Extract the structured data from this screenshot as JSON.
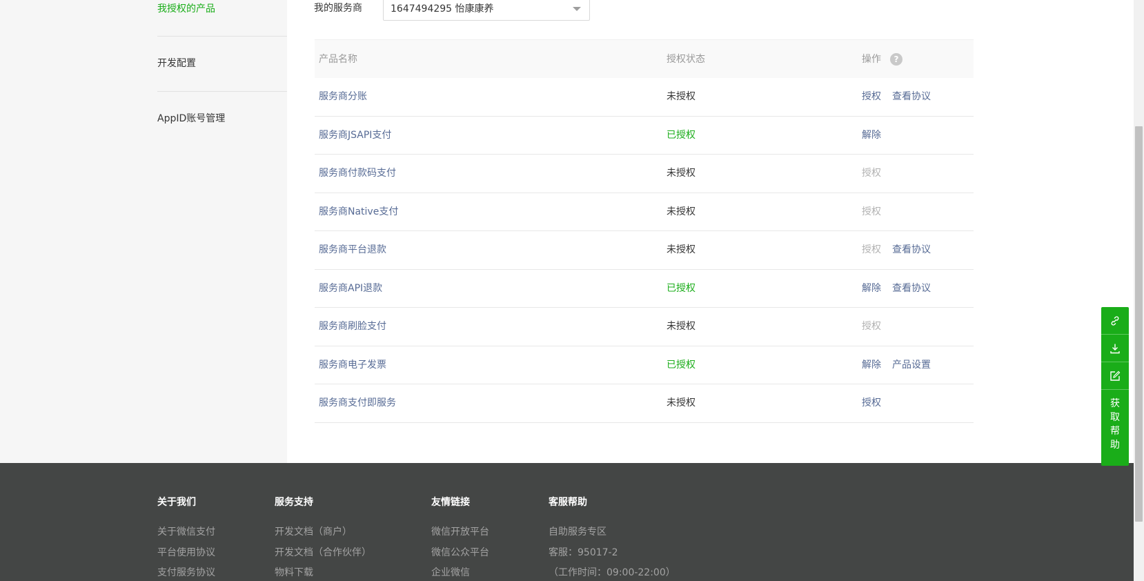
{
  "sidebar": {
    "items": [
      {
        "label": "我授权的产品"
      },
      {
        "label": "开发配置"
      },
      {
        "label": "AppID账号管理"
      }
    ]
  },
  "filter": {
    "label": "我的服务商",
    "selected": "1647494295 怡康康养"
  },
  "table": {
    "headers": {
      "name": "产品名称",
      "status": "授权状态",
      "op": "操作"
    },
    "help_icon": "?",
    "rows": [
      {
        "name": "服务商分账",
        "status": "未授权",
        "op1": "授权",
        "op2": "查看协议"
      },
      {
        "name": "服务商JSAPI支付",
        "status": "已授权",
        "op1": "解除",
        "op2": ""
      },
      {
        "name": "服务商付款码支付",
        "status": "未授权",
        "op1": "授权",
        "op2": ""
      },
      {
        "name": "服务商Native支付",
        "status": "未授权",
        "op1": "授权",
        "op2": ""
      },
      {
        "name": "服务商平台退款",
        "status": "未授权",
        "op1": "授权",
        "op2": "查看协议"
      },
      {
        "name": "服务商API退款",
        "status": "已授权",
        "op1": "解除",
        "op2": "查看协议"
      },
      {
        "name": "服务商刷脸支付",
        "status": "未授权",
        "op1": "授权",
        "op2": ""
      },
      {
        "name": "服务商电子发票",
        "status": "已授权",
        "op1": "解除",
        "op2": "产品设置"
      },
      {
        "name": "服务商支付即服务",
        "status": "未授权",
        "op1": "授权",
        "op2": ""
      }
    ]
  },
  "footer": {
    "col1": {
      "title": "关于我们",
      "links": [
        "关于微信支付",
        "平台使用协议",
        "支付服务协议"
      ]
    },
    "col2": {
      "title": "服务支持",
      "links": [
        "开发文档（商户）",
        "开发文档（合作伙伴）",
        "物料下载"
      ]
    },
    "col3": {
      "title": "友情链接",
      "links": [
        "微信开放平台",
        "微信公众平台",
        "企业微信"
      ]
    },
    "col4": {
      "title": "客服帮助",
      "links": [
        "自助服务专区",
        "客服：95017-2",
        "（工作时间：09:00-22:00）"
      ]
    }
  },
  "float_bar": {
    "icons": [
      "link-icon",
      "download-icon",
      "edit-icon"
    ],
    "help_chars": [
      "获",
      "取",
      "帮",
      "助"
    ]
  },
  "colors": {
    "accent": "#1aad19",
    "link": "#576b95",
    "disabled": "#b2b2b2",
    "footer_bg": "#444645"
  }
}
